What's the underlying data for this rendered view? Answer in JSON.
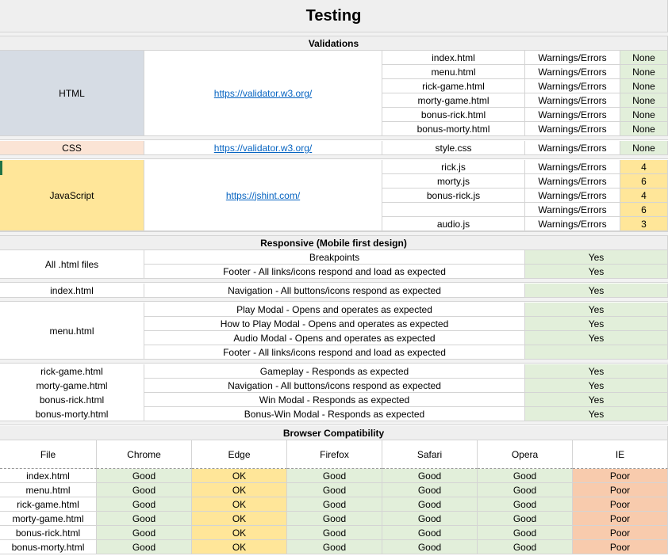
{
  "title": "Testing",
  "validations": {
    "header": "Validations",
    "groups": [
      {
        "label": "HTML",
        "link": "https://validator.w3.org/",
        "rows": [
          {
            "file": "index.html",
            "type": "Warnings/Errors",
            "result": "None"
          },
          {
            "file": "menu.html",
            "type": "Warnings/Errors",
            "result": "None"
          },
          {
            "file": "rick-game.html",
            "type": "Warnings/Errors",
            "result": "None"
          },
          {
            "file": "morty-game.html",
            "type": "Warnings/Errors",
            "result": "None"
          },
          {
            "file": "bonus-rick.html",
            "type": "Warnings/Errors",
            "result": "None"
          },
          {
            "file": "bonus-morty.html",
            "type": "Warnings/Errors",
            "result": "None"
          }
        ]
      },
      {
        "label": "CSS",
        "link": "https://validator.w3.org/",
        "rows": [
          {
            "file": "style.css",
            "type": "Warnings/Errors",
            "result": "None"
          }
        ]
      },
      {
        "label": "JavaScript",
        "link": "https://jshint.com/",
        "rows": [
          {
            "file": "rick.js",
            "type": "Warnings/Errors",
            "result": "4"
          },
          {
            "file": "morty.js",
            "type": "Warnings/Errors",
            "result": "6"
          },
          {
            "file": "bonus-rick.js",
            "type": "Warnings/Errors",
            "result": "4"
          },
          {
            "file": "",
            "type": "Warnings/Errors",
            "result": "6"
          },
          {
            "file": "audio.js",
            "type": "Warnings/Errors",
            "result": "3"
          }
        ]
      }
    ]
  },
  "responsive": {
    "header": "Responsive (Mobile first design)",
    "groups": [
      {
        "files": [
          "All .html files"
        ],
        "rows": [
          {
            "test": "Breakpoints",
            "result": "Yes"
          },
          {
            "test": "Footer - All links/icons respond and load as expected",
            "result": "Yes"
          }
        ]
      },
      {
        "files": [
          "index.html"
        ],
        "rows": [
          {
            "test": "Navigation - All buttons/icons respond as expected",
            "result": "Yes"
          }
        ]
      },
      {
        "files": [
          "menu.html"
        ],
        "rows": [
          {
            "test": "Play Modal - Opens and operates as expected",
            "result": "Yes"
          },
          {
            "test": "How to Play Modal - Opens and operates as expected",
            "result": "Yes"
          },
          {
            "test": "Audio Modal - Opens and operates as expected",
            "result": "Yes"
          },
          {
            "test": "Footer - All links/icons respond and load as expected",
            "result": ""
          }
        ]
      },
      {
        "files": [
          "rick-game.html",
          "morty-game.html",
          "bonus-rick.html",
          "bonus-morty.html"
        ],
        "rows": [
          {
            "test": "Gameplay - Responds as expected",
            "result": "Yes"
          },
          {
            "test": "Navigation - All buttons/icons respond as expected",
            "result": "Yes"
          },
          {
            "test": "Win Modal - Responds as expected",
            "result": "Yes"
          },
          {
            "test": "Bonus-Win Modal - Responds as expected",
            "result": "Yes"
          }
        ]
      }
    ]
  },
  "browser": {
    "header": "Browser Compatibility",
    "columns": [
      "File",
      "Chrome",
      "Edge",
      "Firefox",
      "Safari",
      "Opera",
      "IE"
    ],
    "rows": [
      [
        "index.html",
        "Good",
        "OK",
        "Good",
        "Good",
        "Good",
        "Poor"
      ],
      [
        "menu.html",
        "Good",
        "OK",
        "Good",
        "Good",
        "Good",
        "Poor"
      ],
      [
        "rick-game.html",
        "Good",
        "OK",
        "Good",
        "Good",
        "Good",
        "Poor"
      ],
      [
        "morty-game.html",
        "Good",
        "OK",
        "Good",
        "Good",
        "Good",
        "Poor"
      ],
      [
        "bonus-rick.html",
        "Good",
        "OK",
        "Good",
        "Good",
        "Good",
        "Poor"
      ],
      [
        "bonus-morty.html",
        "Good",
        "OK",
        "Good",
        "Good",
        "Good",
        "Poor"
      ]
    ]
  },
  "colors": {
    "html_group": "#d6dce4",
    "css_group": "#fbe4d5",
    "js_group": "#ffe699",
    "good": "#e2efda",
    "ok": "#ffe699",
    "poor": "#f8cbad",
    "link": "#0563c1"
  }
}
